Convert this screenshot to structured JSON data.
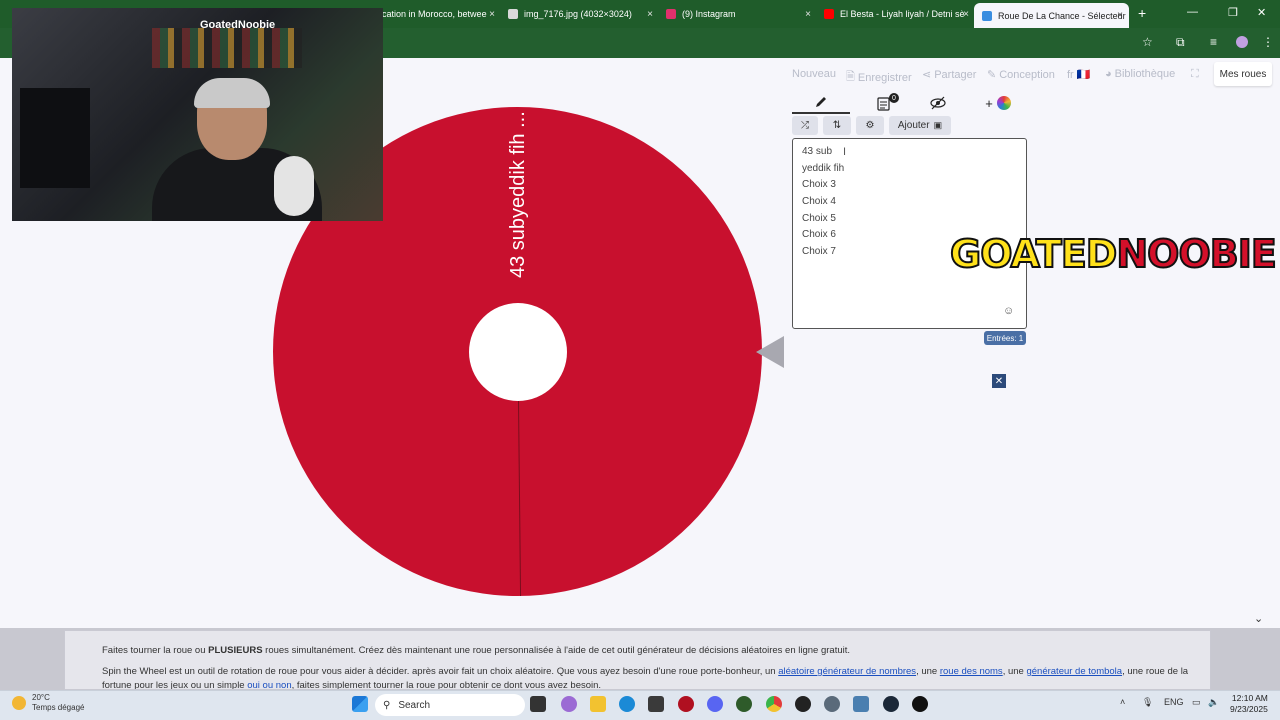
{
  "browser": {
    "tabs": [
      {
        "label": "",
        "color": "#e23b3b"
      },
      {
        "label": "",
        "color": "#6b4fbf"
      },
      {
        "label": "Education in Morocco, betwee",
        "color": "#2a7fd4"
      },
      {
        "label": "img_7176.jpg (4032×3024)",
        "color": "#d9d9d9"
      },
      {
        "label": "(9) Instagram",
        "color": "#e1306c"
      },
      {
        "label": "El Besta - Liyah liyah / Detni sè",
        "color": "#ff0000"
      },
      {
        "label": "Roue De La Chance - Sélecteur",
        "color": "#3a8de0"
      }
    ],
    "close_glyph": "×",
    "new_tab": "+",
    "window_controls": [
      "—",
      "❐",
      "✕"
    ],
    "toolbar_icons": [
      "star-icon",
      "extensions-icon",
      "media-icon",
      "profile-icon",
      "menu-icon"
    ]
  },
  "webcam": {
    "title": "GoatedNoobie"
  },
  "header": {
    "links": [
      {
        "icon": "",
        "label": "Nouveau"
      },
      {
        "icon": "🗎",
        "label": "Enregistrer"
      },
      {
        "icon": "⋖",
        "label": "Partager"
      },
      {
        "icon": "✎",
        "label": "Conception"
      },
      {
        "icon": "",
        "label": "fr 🇫🇷"
      },
      {
        "icon": "◕",
        "label": "Bibliothèque"
      },
      {
        "icon": "⛶",
        "label": ""
      }
    ],
    "my_wheels": "Mes roues"
  },
  "wheel": {
    "segment_label": "43 subyeddik fih ...",
    "color": "#c8102e"
  },
  "editor": {
    "tabs": [
      "edit-icon",
      "results-icon",
      "hide-icon",
      "add-color-icon"
    ],
    "results_badge": "0",
    "tools": {
      "shuffle": "⤮",
      "sort": "⇅",
      "settings": "⚙",
      "add_label": "Ajouter"
    },
    "entries": [
      "43 sub",
      "yeddik fih",
      "Choix 3",
      "Choix 4",
      "Choix 5",
      "Choix 6",
      "Choix 7"
    ],
    "entries_count": "Entrées: 1",
    "emoji": "☺"
  },
  "overlay": {
    "logo_part1": "GOATED",
    "logo_part2": "NOOBIE",
    "close": "✕"
  },
  "footer": {
    "line1_pre": "Faites tourner la roue ou ",
    "line1_bold": "PLUSIEURS",
    "line1_post": " roues simultanément. Créez dès maintenant une roue personnalisée à l'aide de cet outil générateur de décisions aléatoires en ligne gratuit.",
    "line2_a": "Spin the Wheel est un outil de rotation de roue pour vous aider à décider. après avoir fait un choix aléatoire. Que vous ayez besoin d'une roue porte-bonheur, un ",
    "line2_link1": "aléatoire générateur de nombres",
    "line2_b": ", une ",
    "line2_link2": "roue des noms",
    "line2_c": ", une ",
    "line2_link3": "générateur de tombola",
    "line2_d": ", une roue de la",
    "line3_a": "fortune pour les jeux ou un simple ",
    "line3_link": "oui ou non",
    "line3_b": ", faites simplement tourner la roue pour obtenir ce dont vous avez besoin."
  },
  "taskbar": {
    "weather_temp": "20°C",
    "weather_desc": "Temps dégagé",
    "search_placeholder": "Search",
    "lang": "ENG",
    "time": "12:10 AM",
    "date": "9/23/2025"
  }
}
